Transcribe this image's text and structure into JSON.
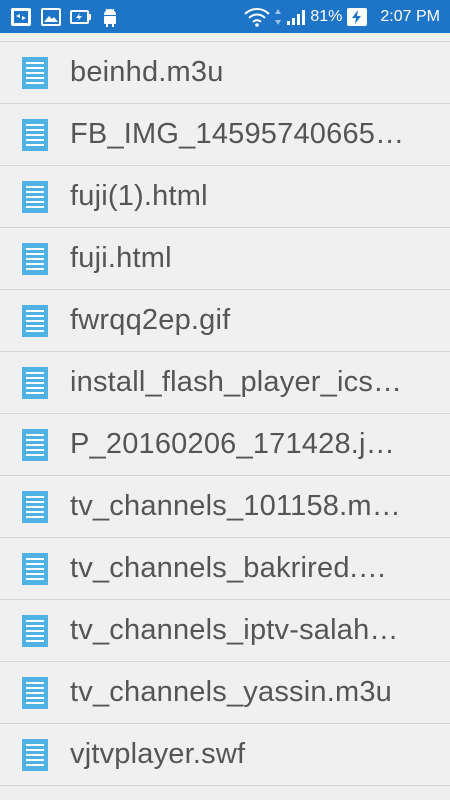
{
  "status_bar": {
    "battery_percent": "81%",
    "time": "2:07 PM",
    "icons": [
      "screenshot-icon",
      "image-icon",
      "battery-saver-icon",
      "android-icon",
      "wifi-icon",
      "signal-icon",
      "battery-charging-icon"
    ]
  },
  "files": [
    {
      "name": "beinhd.m3u"
    },
    {
      "name": "FB_IMG_14595740665…"
    },
    {
      "name": "fuji(1).html"
    },
    {
      "name": "fuji.html"
    },
    {
      "name": "fwrqq2ep.gif"
    },
    {
      "name": "install_flash_player_ics…"
    },
    {
      "name": "P_20160206_171428.j…"
    },
    {
      "name": "tv_channels_101158.m…"
    },
    {
      "name": "tv_channels_bakrired.…"
    },
    {
      "name": "tv_channels_iptv-salah…"
    },
    {
      "name": "tv_channels_yassin.m3u"
    },
    {
      "name": "vjtvplayer.swf"
    }
  ],
  "colors": {
    "status_bar": "#1e74c6",
    "file_icon": "#4fb2e3",
    "text": "#555555",
    "divider": "#d6d6d6"
  }
}
